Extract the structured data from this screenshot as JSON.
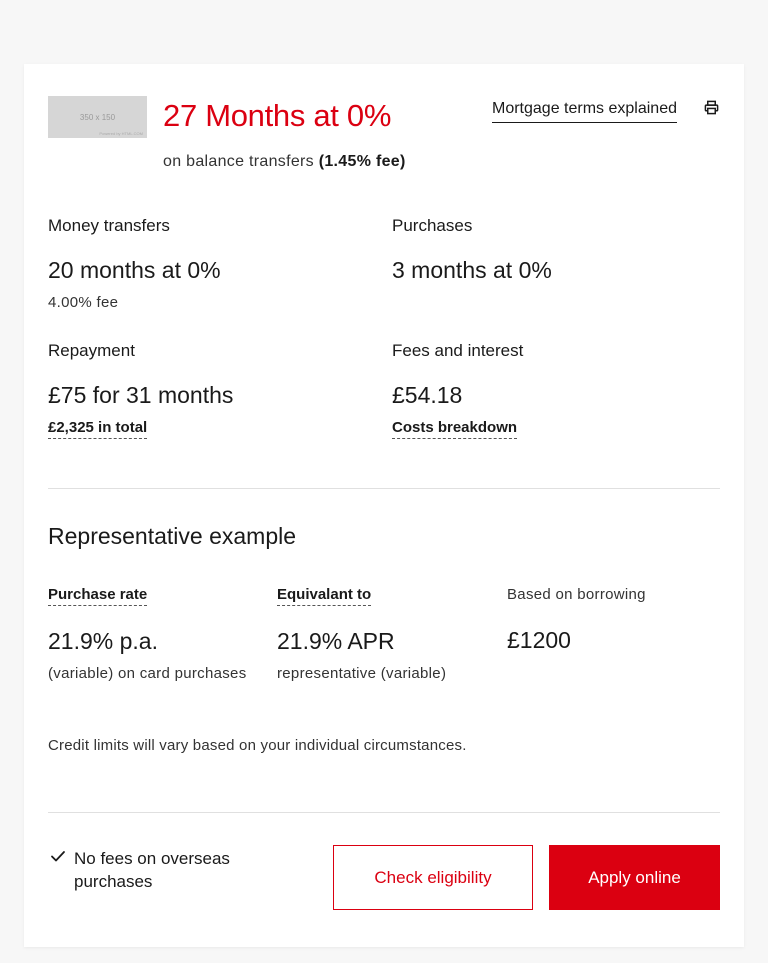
{
  "hero": {
    "thumbnail_text": "350 x 150",
    "thumbnail_credit": "Powered by HTML.COM",
    "headline": "27 Months at 0%",
    "subline_text": "on balance transfers",
    "subline_fee": "(1.45% fee)",
    "terms_link": "Mortgage terms explained",
    "print_icon": "print-icon"
  },
  "features": {
    "money_transfers": {
      "label": "Money transfers",
      "value": "20 months at 0%",
      "detail": "4.00% fee"
    },
    "purchases": {
      "label": "Purchases",
      "value": "3 months at 0%"
    },
    "repayment": {
      "label": "Repayment",
      "value": "£75 for 31 months",
      "link": "£2,325 in total"
    },
    "fees": {
      "label": "Fees and interest",
      "value": "£54.18",
      "link": "Costs breakdown"
    }
  },
  "example": {
    "title": "Representative example",
    "purchase_rate": {
      "label": "Purchase rate",
      "value": "21.9% p.a.",
      "detail": "(variable) on card purchases"
    },
    "equivalent": {
      "label": "Equivalant to",
      "value": "21.9% APR",
      "detail": "representative (variable)"
    },
    "borrowing": {
      "label": "Based on borrowing",
      "value": "£1200"
    },
    "note": "Credit limits will vary based on your individual circumstances."
  },
  "footer": {
    "benefit": "No fees on overseas purchases",
    "check_button": "Check eligibility",
    "apply_button": "Apply online"
  },
  "colors": {
    "accent": "#db0011",
    "text": "#1a1a1a",
    "background": "#f7f7f7",
    "card": "#ffffff"
  }
}
